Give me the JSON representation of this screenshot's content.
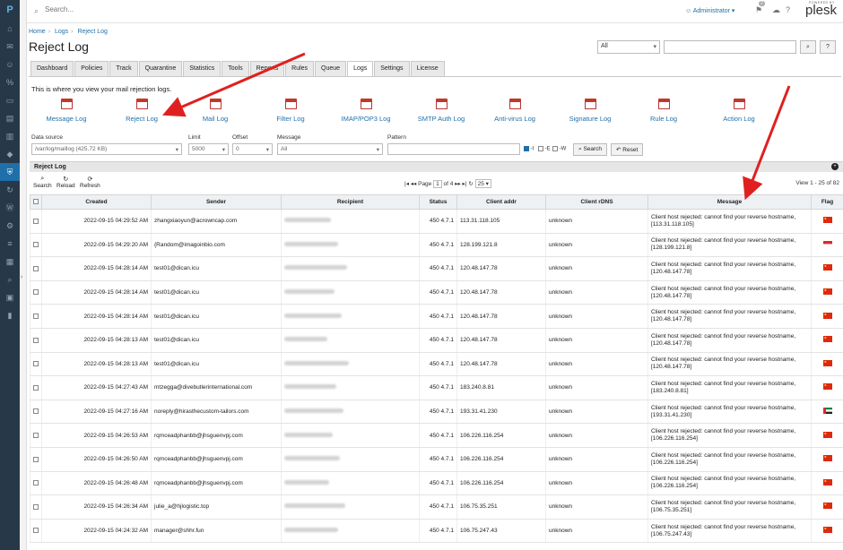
{
  "app": {
    "search_placeholder": "Search...",
    "user": "Administrator",
    "notifications_count": "2",
    "powered_by": "POWERED BY",
    "brand": "plesk"
  },
  "breadcrumb": [
    "Home",
    "Logs",
    "Reject Log"
  ],
  "page_title": "Reject Log",
  "filter": {
    "select_value": "All",
    "search_button": "⌕",
    "help_button": "?"
  },
  "tabs": [
    {
      "label": "Dashboard",
      "active": false
    },
    {
      "label": "Policies",
      "active": false
    },
    {
      "label": "Track",
      "active": false
    },
    {
      "label": "Quarantine",
      "active": false
    },
    {
      "label": "Statistics",
      "active": false
    },
    {
      "label": "Tools",
      "active": false
    },
    {
      "label": "Reports",
      "active": false
    },
    {
      "label": "Rules",
      "active": false
    },
    {
      "label": "Queue",
      "active": false
    },
    {
      "label": "Logs",
      "active": true
    },
    {
      "label": "Settings",
      "active": false
    },
    {
      "label": "License",
      "active": false
    }
  ],
  "intro": "This is where you view your mail rejection logs.",
  "log_types": [
    "Message Log",
    "Reject Log",
    "Mail Log",
    "Filter Log",
    "IMAP/POP3 Log",
    "SMTP Auth Log",
    "Anti-virus Log",
    "Signature Log",
    "Rule Log",
    "Action Log"
  ],
  "fields": {
    "data_source_label": "Data source",
    "data_source_value": "/var/log/maillog (425.72 KB)",
    "limit_label": "Limit",
    "limit_value": "5000",
    "offset_label": "Offset",
    "offset_value": "0",
    "message_label": "Message",
    "message_value": "All",
    "pattern_label": "Pattern",
    "opt_i": "-I",
    "opt_e": "-E",
    "opt_w": "-W",
    "search_btn": "Search",
    "reset_btn": "Reset"
  },
  "panel": {
    "title": "Reject Log",
    "tools": [
      "Search",
      "Reload",
      "Refresh"
    ],
    "page_label": "Page",
    "page_value": "1",
    "page_of": "of 4",
    "per_page": "25",
    "view_info": "View 1 - 25 of 82"
  },
  "table": {
    "columns": [
      "",
      "Created",
      "Sender",
      "Recipient",
      "Status",
      "Client addr",
      "Client rDNS",
      "Message",
      "Flag"
    ],
    "rows": [
      {
        "created": "2022-09-15 04:29:52 AM",
        "sender": "zhangxiaoyun@acrowncap.com",
        "status": "450 4.7.1",
        "addr": "113.31.118.105",
        "rdns": "unknown",
        "msg": "Client host rejected: cannot find your reverse hostname, [113.31.118.105]",
        "flag": "cn"
      },
      {
        "created": "2022-09-15 04:29:20 AM",
        "sender": "{Random@imagoinbio.com",
        "status": "450 4.7.1",
        "addr": "128.199.121.8",
        "rdns": "unknown",
        "msg": "Client host rejected: cannot find your reverse hostname, [128.199.121.8]",
        "flag": "sg"
      },
      {
        "created": "2022-09-15 04:28:14 AM",
        "sender": "test01@dican.icu",
        "status": "450 4.7.1",
        "addr": "120.48.147.78",
        "rdns": "unknown",
        "msg": "Client host rejected: cannot find your reverse hostname, [120.48.147.78]",
        "flag": "cn"
      },
      {
        "created": "2022-09-15 04:28:14 AM",
        "sender": "test01@dican.icu",
        "status": "450 4.7.1",
        "addr": "120.48.147.78",
        "rdns": "unknown",
        "msg": "Client host rejected: cannot find your reverse hostname, [120.48.147.78]",
        "flag": "cn"
      },
      {
        "created": "2022-09-15 04:28:14 AM",
        "sender": "test01@dican.icu",
        "status": "450 4.7.1",
        "addr": "120.48.147.78",
        "rdns": "unknown",
        "msg": "Client host rejected: cannot find your reverse hostname, [120.48.147.78]",
        "flag": "cn"
      },
      {
        "created": "2022-09-15 04:28:13 AM",
        "sender": "test01@dican.icu",
        "status": "450 4.7.1",
        "addr": "120.48.147.78",
        "rdns": "unknown",
        "msg": "Client host rejected: cannot find your reverse hostname, [120.48.147.78]",
        "flag": "cn"
      },
      {
        "created": "2022-09-15 04:28:13 AM",
        "sender": "test01@dican.icu",
        "status": "450 4.7.1",
        "addr": "120.48.147.78",
        "rdns": "unknown",
        "msg": "Client host rejected: cannot find your reverse hostname, [120.48.147.78]",
        "flag": "cn"
      },
      {
        "created": "2022-09-15 04:27:43 AM",
        "sender": "mtzegga@divebutlerinternational.com",
        "status": "450 4.7.1",
        "addr": "183.240.8.81",
        "rdns": "unknown",
        "msg": "Client host rejected: cannot find your reverse hostname, [183.240.8.81]",
        "flag": "cn"
      },
      {
        "created": "2022-09-15 04:27:16 AM",
        "sender": "noreply@hirasthecustom-tailors.com",
        "status": "450 4.7.1",
        "addr": "193.31.41.230",
        "rdns": "unknown",
        "msg": "Client host rejected: cannot find your reverse hostname, [193.31.41.230]",
        "flag": "ae"
      },
      {
        "created": "2022-09-15 04:26:53 AM",
        "sender": "rqmceadphanbb@jhsguenvpj.com",
        "status": "450 4.7.1",
        "addr": "106.226.116.254",
        "rdns": "unknown",
        "msg": "Client host rejected: cannot find your reverse hostname, [106.226.116.254]",
        "flag": "cn"
      },
      {
        "created": "2022-09-15 04:26:50 AM",
        "sender": "rqmceadphanbb@jhsguenvpj.com",
        "status": "450 4.7.1",
        "addr": "106.226.116.254",
        "rdns": "unknown",
        "msg": "Client host rejected: cannot find your reverse hostname, [106.226.116.254]",
        "flag": "cn"
      },
      {
        "created": "2022-09-15 04:26:48 AM",
        "sender": "rqmceadphanbb@jhsguenvpj.com",
        "status": "450 4.7.1",
        "addr": "106.226.116.254",
        "rdns": "unknown",
        "msg": "Client host rejected: cannot find your reverse hostname, [106.226.116.254]",
        "flag": "cn"
      },
      {
        "created": "2022-09-15 04:26:34 AM",
        "sender": "julie_a@hjlogistic.top",
        "status": "450 4.7.1",
        "addr": "106.75.35.251",
        "rdns": "unknown",
        "msg": "Client host rejected: cannot find your reverse hostname, [106.75.35.251]",
        "flag": "cn"
      },
      {
        "created": "2022-09-15 04:24:32 AM",
        "sender": "manager@shhr.fun",
        "status": "450 4.7.1",
        "addr": "106.75.247.43",
        "rdns": "unknown",
        "msg": "Client host rejected: cannot find your reverse hostname, [106.75.247.43]",
        "flag": "cn"
      }
    ]
  },
  "colors": {
    "link": "#1f6fa8",
    "sidebar": "#273848",
    "annotation_arrow": "#e02020"
  }
}
